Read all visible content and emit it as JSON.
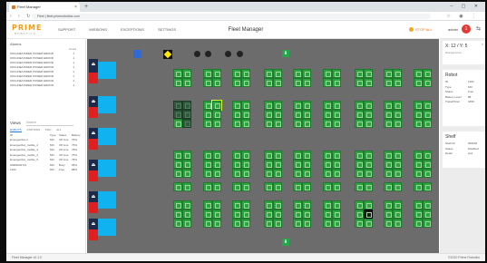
{
  "browser": {
    "tab_title": "Fleet Manager",
    "url": "Fleet  |  fleet.primerobotics.com",
    "new_tab": "+",
    "tab_close": "×",
    "window_controls": "–  ▢  ✕",
    "nav_buttons": "‹ › ↻",
    "toolbar_icons": "☆ ◉ ⋮"
  },
  "header": {
    "logo": "PRIME",
    "logo_sub": "ROBOTICS",
    "nav": [
      "SUPPORT",
      "MISSIONS",
      "EXCEPTIONS",
      "SETTINGS"
    ],
    "title": "Fleet Manager",
    "stop_all": "STOP ALL",
    "user": "admin",
    "avatar": "1",
    "menu_icon": "⇆"
  },
  "alarms": {
    "title": "Alarms",
    "col_header": "Count",
    "rows": [
      {
        "label": "OFFLINE/UNDER POWER ERROR",
        "count": "1"
      },
      {
        "label": "OFFLINE/UNDER POWER ERROR",
        "count": "1"
      },
      {
        "label": "OFFLINE/UNDER POWER ERROR",
        "count": "1"
      },
      {
        "label": "OFFLINE/UNDER POWER ERROR",
        "count": "1"
      },
      {
        "label": "OFFLINE/UNDER POWER ERROR",
        "count": "1"
      },
      {
        "label": "OFFLINE/UNDER POWER ERROR",
        "count": "1"
      },
      {
        "label": "OFFLINE/UNDER POWER ERROR",
        "count": "1"
      },
      {
        "label": "OFFLINE/UNDER POWER ERROR",
        "count": "1"
      }
    ]
  },
  "views": {
    "title": "Views",
    "search_placeholder": "Search",
    "tabs": [
      "ROBOTS",
      "STATIONS",
      "POD",
      "ALL"
    ],
    "grid_title": "ID",
    "columns": [
      "Type",
      "Status",
      "Battery"
    ],
    "rows": [
      {
        "id": "Emergentbot-1",
        "type": "MO",
        "status": "Off Line",
        "battery": "75%"
      },
      {
        "id": "Emergentbot_mobile_2",
        "type": "MO",
        "status": "Off Line",
        "battery": "75%"
      },
      {
        "id": "Emergentbot_mobile_3",
        "type": "MO",
        "status": "Off Line",
        "battery": "75%"
      },
      {
        "id": "Emergentbot_mobile_4",
        "type": "MO",
        "status": "Off Line",
        "battery": "75%"
      },
      {
        "id": "Emergentbot_mobile_5",
        "type": "MO",
        "status": "Off Line",
        "battery": "75%"
      },
      {
        "id": "AMR0002721",
        "type": "MO",
        "status": "Busy",
        "battery": "95%"
      },
      {
        "id": "1202",
        "type": "MO",
        "status": "Free",
        "battery": "88%"
      }
    ]
  },
  "map": {
    "pod_color": "#2ba33f",
    "station_color": "#10b3f0",
    "alert_color": "#e02020",
    "station_icon": "⏏",
    "entry_icon": "⬇"
  },
  "right": {
    "coords": "X: 12 / Y: 5",
    "coords_sub": "Storage Area",
    "close": "×",
    "robot": {
      "title": "Robot",
      "rows": [
        {
          "k": "ID",
          "v": "1202"
        },
        {
          "k": "Type",
          "v": "MO"
        },
        {
          "k": "Status",
          "v": "Free"
        },
        {
          "k": "Battery Level",
          "v": "88"
        },
        {
          "k": "Travel/Total",
          "v": "3456"
        }
      ]
    },
    "shelf": {
      "title": "Shelf",
      "rows": [
        {
          "k": "Shelf ID",
          "v": "000108"
        },
        {
          "k": "Status",
          "v": "Disabled"
        },
        {
          "k": "Detail",
          "v": "pod"
        }
      ]
    }
  },
  "footer": {
    "left": "Fleet Manager v0.1.0",
    "right": "©2020 Prime Robotics"
  }
}
